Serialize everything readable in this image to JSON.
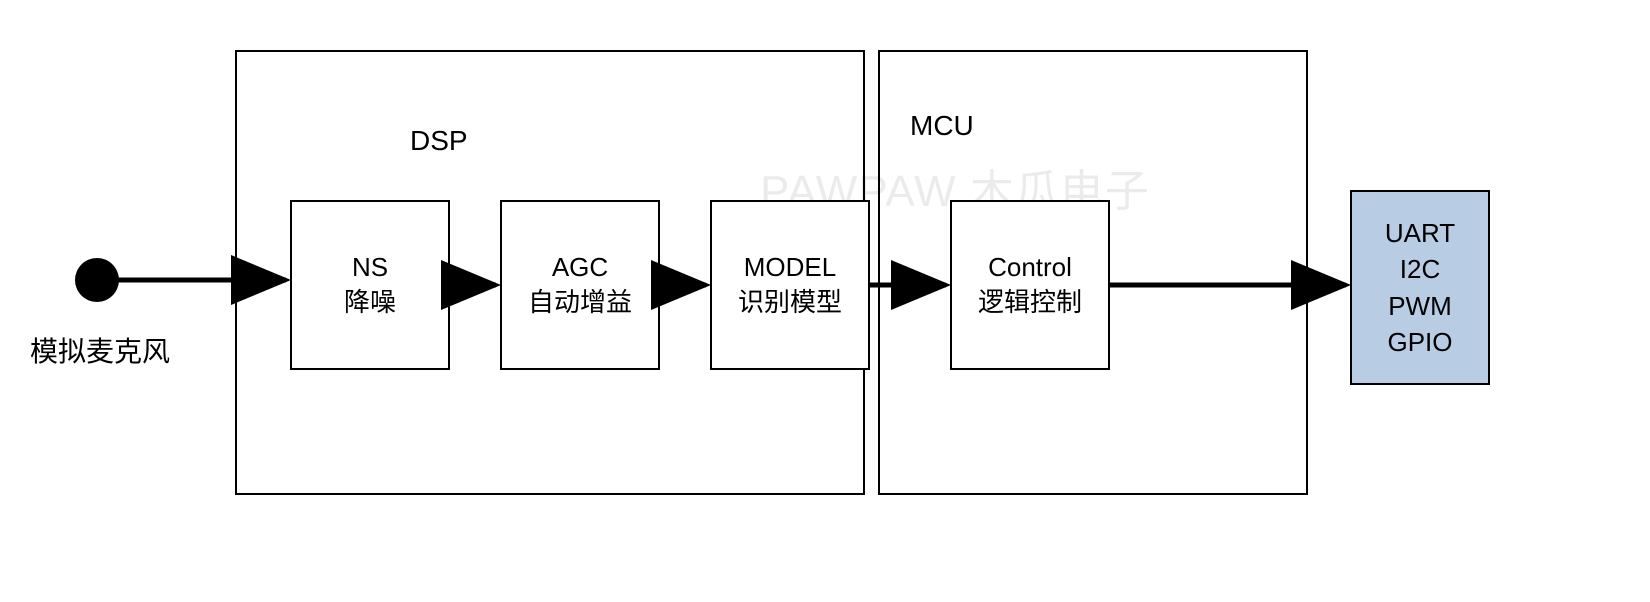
{
  "watermark": "PAWPAW 木瓜电子",
  "mic": {
    "label": "模拟麦克风"
  },
  "dsp": {
    "label": "DSP",
    "blocks": {
      "ns": {
        "line1": "NS",
        "line2": "降噪"
      },
      "agc": {
        "line1": "AGC",
        "line2": "自动增益"
      },
      "model": {
        "line1": "MODEL",
        "line2": "识别模型"
      }
    }
  },
  "mcu": {
    "label": "MCU",
    "blocks": {
      "control": {
        "line1": "Control",
        "line2": "逻辑控制"
      }
    }
  },
  "output": {
    "line1": "UART",
    "line2": "I2C",
    "line3": "PWM",
    "line4": "GPIO"
  }
}
